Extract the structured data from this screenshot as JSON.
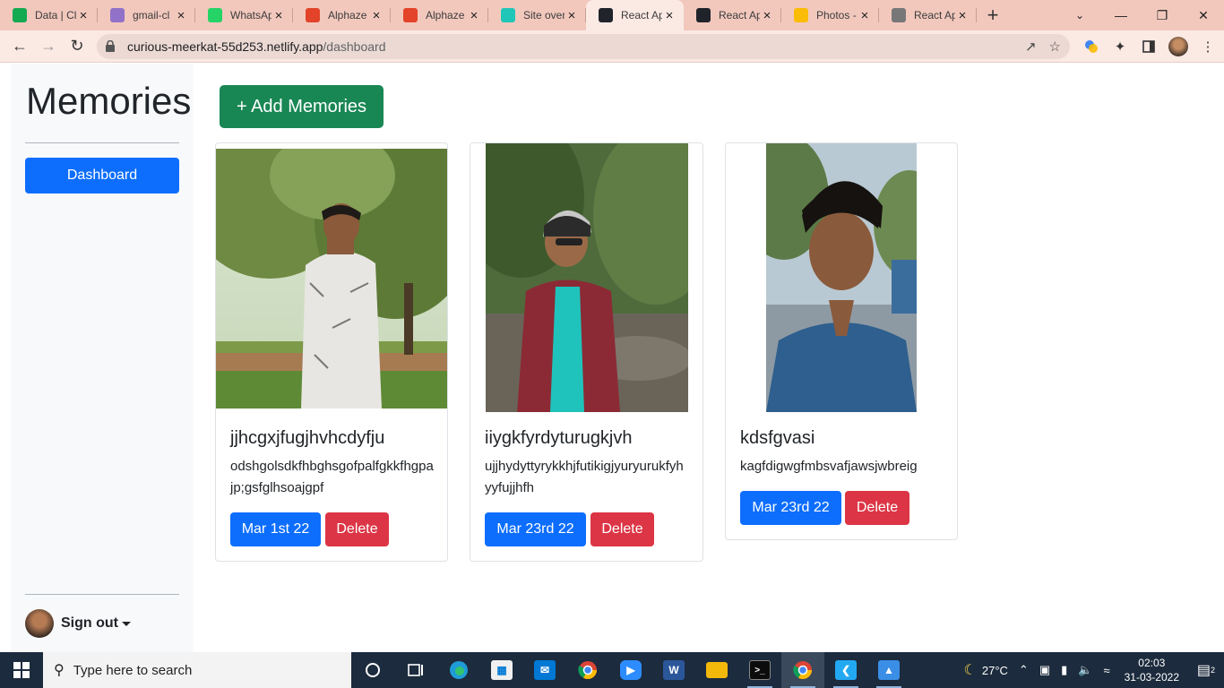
{
  "browser": {
    "tabs": [
      {
        "title": "Data | Cl",
        "icon": "mongodb-icon",
        "color": "#13aa52"
      },
      {
        "title": "gmail-cl",
        "icon": "heroku-icon",
        "color": "#9271c8"
      },
      {
        "title": "WhatsAp",
        "icon": "whatsapp-icon",
        "color": "#25d366"
      },
      {
        "title": "Alphaze",
        "icon": "gitlab-icon",
        "color": "#e24329"
      },
      {
        "title": "Alphaze",
        "icon": "gitlab-icon",
        "color": "#e24329"
      },
      {
        "title": "Site over",
        "icon": "netlify-icon",
        "color": "#20c6b7"
      },
      {
        "title": "React Ap",
        "icon": "react-icon",
        "color": "#20232a",
        "active": true
      },
      {
        "title": "React Ap",
        "icon": "react-icon",
        "color": "#20232a"
      },
      {
        "title": "Photos -",
        "icon": "google-photos-icon",
        "color": "#fbbc05"
      },
      {
        "title": "React Ap",
        "icon": "globe-icon",
        "color": "#777777"
      }
    ],
    "url_host": "curious-meerkat-55d253.netlify.app",
    "url_path": "/dashboard"
  },
  "sidebar": {
    "brand": "Memories",
    "nav_dashboard": "Dashboard",
    "user_label": "Sign out"
  },
  "main": {
    "add_button": "+ Add Memories"
  },
  "cards": [
    {
      "title": "jjhcgxjfugjhvhcdyfju",
      "text": "odshgolsdkfhbghsgofpalfgkkfhgpajp;gsfglhsoajgpf",
      "date": "Mar 1st 22",
      "delete": "Delete",
      "photo": "man-in-white-shirt-park-photo"
    },
    {
      "title": "iiygkfyrdyturugkjvh",
      "text": "ujjhydyttyrykkhjfutikigjyuryurukfyhyyfujjhfh",
      "date": "Mar 23rd 22",
      "delete": "Delete",
      "photo": "man-in-red-shirt-beanie-photo"
    },
    {
      "title": "kdsfgvasi",
      "text": "kagfdigwgfmbsvafjawsjwbreig",
      "date": "Mar 23rd 22",
      "delete": "Delete",
      "photo": "man-selfie-blue-shirt-photo"
    }
  ],
  "taskbar": {
    "search_placeholder": "Type here to search",
    "temperature": "27°C",
    "time": "02:03",
    "date": "31-03-2022",
    "notifications": "2"
  },
  "colors": {
    "primary": "#0d6efd",
    "success": "#198754",
    "danger": "#dc3545",
    "sidebar_bg": "#f8f9fa",
    "tabstrip_bg": "#f2c8bd"
  }
}
